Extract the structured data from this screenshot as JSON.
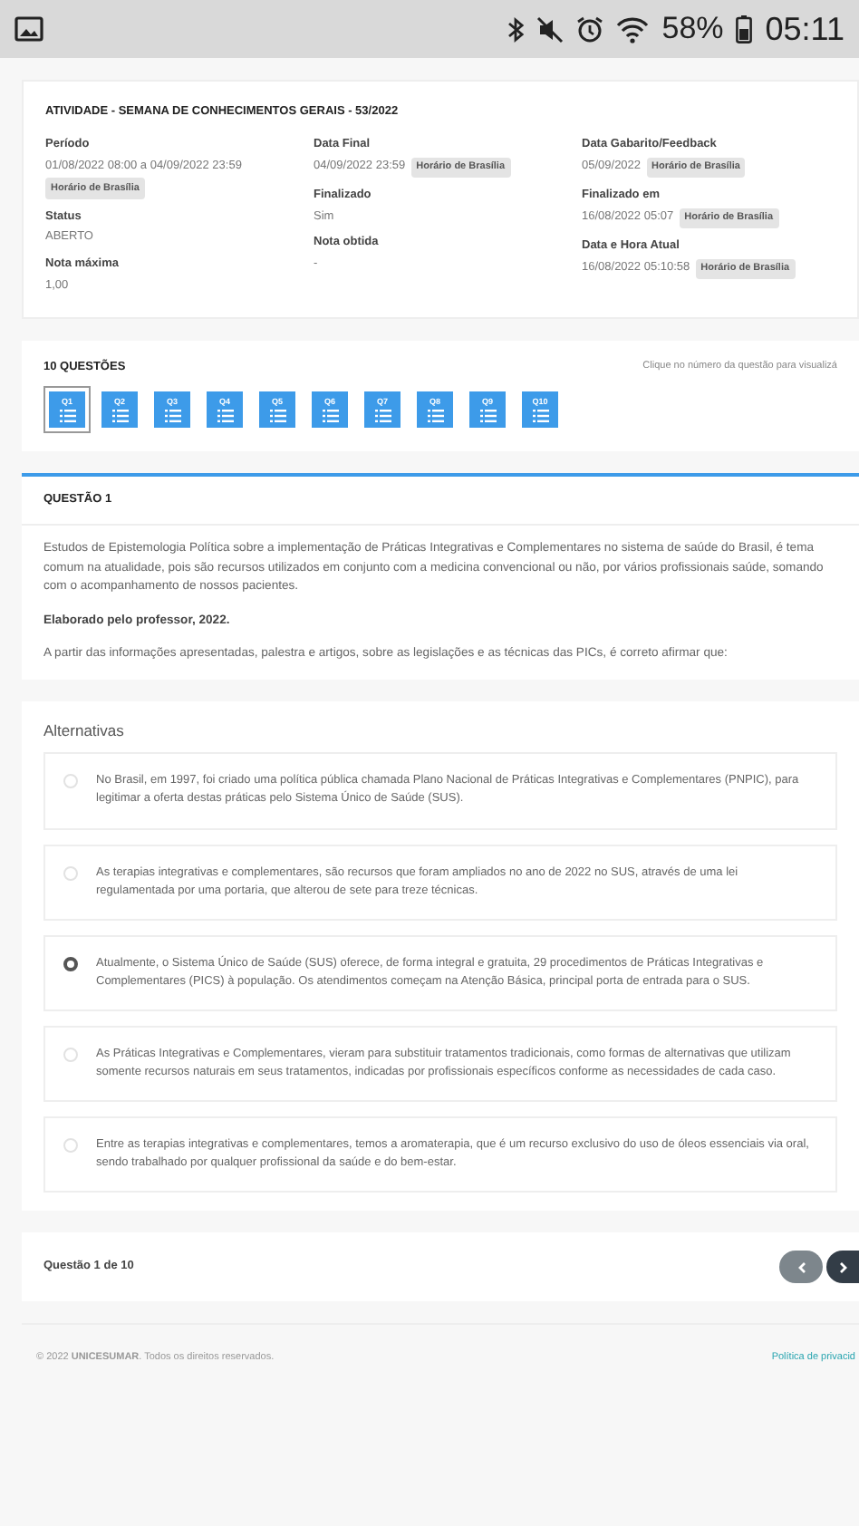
{
  "status_bar": {
    "battery": "58%",
    "time": "05:11"
  },
  "activity": {
    "title": "ATIVIDADE - SEMANA DE CONHECIMENTOS GERAIS - 53/2022",
    "columns": [
      [
        {
          "label": "Período",
          "value": "01/08/2022 08:00 a 04/09/2022 23:59",
          "badge": "Horário de Brasília"
        },
        {
          "label": "Status",
          "value": "ABERTO"
        },
        {
          "label": "Nota máxima",
          "value": "1,00"
        }
      ],
      [
        {
          "label": "Data Final",
          "value": "04/09/2022 23:59",
          "badge": "Horário de Brasília"
        },
        {
          "label": "Finalizado",
          "value": "Sim"
        },
        {
          "label": "Nota obtida",
          "value": "-"
        }
      ],
      [
        {
          "label": "Data Gabarito/Feedback",
          "value": "05/09/2022",
          "badge": "Horário de Brasília"
        },
        {
          "label": "Finalizado em",
          "value": "16/08/2022 05:07",
          "badge": "Horário de Brasília"
        },
        {
          "label": "Data e Hora Atual",
          "value": "16/08/2022 05:10:58",
          "badge": "Horário de Brasília"
        }
      ]
    ]
  },
  "questions": {
    "heading": "10 QUESTÕES",
    "hint": "Clique no número da questão para visualizá",
    "items": [
      {
        "label": "Q1",
        "selected": true
      },
      {
        "label": "Q2",
        "selected": false
      },
      {
        "label": "Q3",
        "selected": false
      },
      {
        "label": "Q4",
        "selected": false
      },
      {
        "label": "Q5",
        "selected": false
      },
      {
        "label": "Q6",
        "selected": false
      },
      {
        "label": "Q7",
        "selected": false
      },
      {
        "label": "Q8",
        "selected": false
      },
      {
        "label": "Q9",
        "selected": false
      },
      {
        "label": "Q10",
        "selected": false
      }
    ]
  },
  "question": {
    "heading": "QUESTÃO 1",
    "paragraphs": [
      {
        "kind": "text",
        "text": "Estudos de Epistemologia Política sobre a implementação de Práticas Integrativas e Complementares no sistema de saúde do Brasil, é tema comum na atualidade, pois são recursos utilizados em conjunto com a medicina convencional ou não, por vários profissionais saúde, somando com o acompanhamento de nossos pacientes."
      },
      {
        "kind": "source",
        "text": "Elaborado pelo professor, 2022."
      },
      {
        "kind": "text",
        "text": "A partir das informações apresentadas, palestra e artigos, sobre as legislações e as técnicas das PICs, é correto afirmar que:"
      }
    ]
  },
  "alternatives": {
    "heading": "Alternativas",
    "items": [
      {
        "text": "No Brasil, em 1997, foi criado uma política pública chamada Plano Nacional de Práticas Integrativas e Complementares (PNPIC), para legitimar a oferta destas práticas pelo Sistema Único de Saúde (SUS).",
        "selected": false
      },
      {
        "text": "As terapias integrativas e complementares, são recursos que foram ampliados no ano de 2022 no SUS, através de uma lei regulamentada por uma portaria, que alterou de sete para treze técnicas.",
        "selected": false
      },
      {
        "text": "Atualmente, o Sistema Único de Saúde (SUS) oferece, de forma integral e gratuita, 29 procedimentos de Práticas Integrativas e Complementares (PICS) à população. Os atendimentos começam na Atenção Básica, principal porta de entrada para o SUS.",
        "selected": true
      },
      {
        "text": "As Práticas Integrativas e Complementares, vieram para substituir tratamentos tradicionais, como formas de alternativas que utilizam somente recursos naturais em seus tratamentos, indicadas por profissionais específicos conforme as necessidades de cada caso.",
        "selected": false
      },
      {
        "text": "Entre as terapias integrativas e complementares, temos a aromaterapia, que é um recurso exclusivo do uso de óleos essenciais via oral, sendo trabalhado por qualquer profissional da saúde e do bem-estar.",
        "selected": false
      }
    ]
  },
  "pager": {
    "label": "Questão 1 de 10",
    "prev_disabled": true
  },
  "footer": {
    "copyright": "© 2022 **UNICESUMAR**. Todos os direitos reservados.",
    "link": "Política de privacid"
  }
}
